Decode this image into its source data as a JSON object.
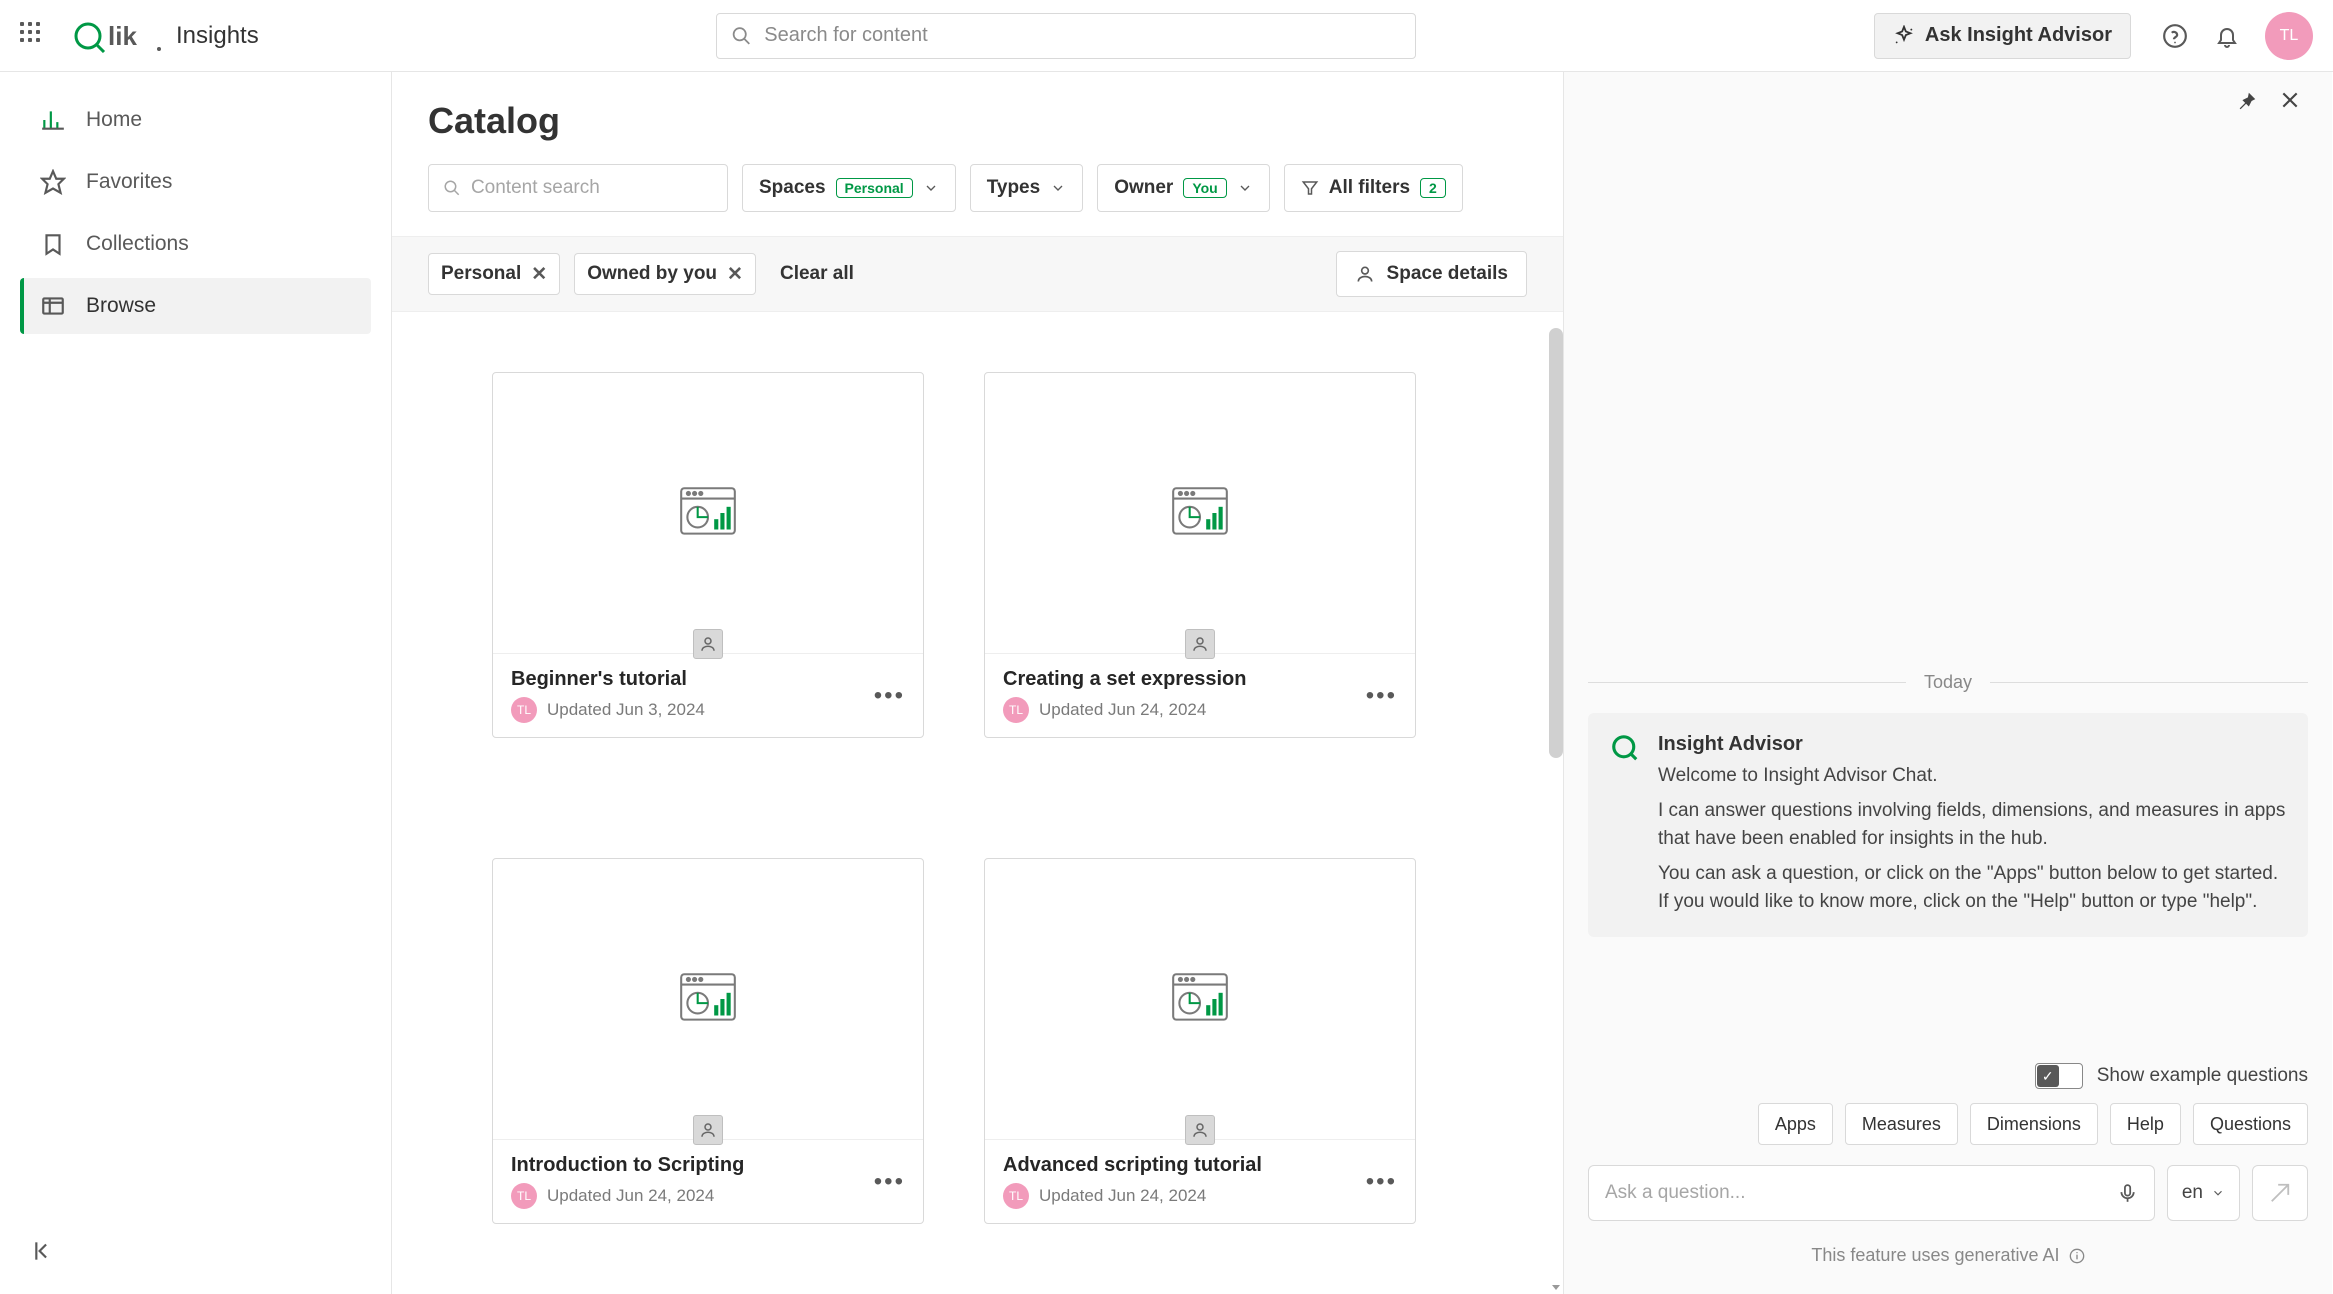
{
  "header": {
    "product": "Insights",
    "search_placeholder": "Search for content",
    "ask_label": "Ask Insight Advisor",
    "avatar_initials": "TL"
  },
  "sidebar": {
    "items": [
      {
        "label": "Home"
      },
      {
        "label": "Favorites"
      },
      {
        "label": "Collections"
      },
      {
        "label": "Browse"
      }
    ]
  },
  "catalog": {
    "title": "Catalog",
    "content_search_placeholder": "Content search",
    "filters": {
      "spaces_label": "Spaces",
      "spaces_badge": "Personal",
      "types_label": "Types",
      "owner_label": "Owner",
      "owner_badge": "You",
      "allfilters_label": "All filters",
      "allfilters_count": "2"
    },
    "chips": {
      "personal": "Personal",
      "ownedby": "Owned by you",
      "clear": "Clear all"
    },
    "space_details": "Space details",
    "cards": [
      {
        "title": "Beginner's tutorial",
        "updated_prefix": "Updated ",
        "date": "Jun 3, 2024",
        "avatar_initials": "TL"
      },
      {
        "title": "Creating a set expression",
        "updated_prefix": "Updated ",
        "date": "Jun 24, 2024",
        "avatar_initials": "TL"
      },
      {
        "title": "Introduction to Scripting",
        "updated_prefix": "Updated ",
        "date": "Jun 24, 2024",
        "avatar_initials": "TL"
      },
      {
        "title": "Advanced scripting tutorial",
        "updated_prefix": "Updated ",
        "date": "Jun 24, 2024",
        "avatar_initials": "TL"
      }
    ]
  },
  "insight": {
    "today_label": "Today",
    "bot_name": "Insight Advisor",
    "welcome_line1": "Welcome to Insight Advisor Chat.",
    "welcome_line2": "I can answer questions involving fields, dimensions, and measures in apps that have been enabled for insights in the hub.",
    "welcome_line3": "You can ask a question, or click on the \"Apps\" button below to get started. If you would like to know more, click on the \"Help\" button or type \"help\".",
    "toggle_label": "Show example questions",
    "pills": [
      "Apps",
      "Measures",
      "Dimensions",
      "Help",
      "Questions"
    ],
    "ask_placeholder": "Ask a question...",
    "lang": "en",
    "ai_notice": "This feature uses generative AI"
  }
}
